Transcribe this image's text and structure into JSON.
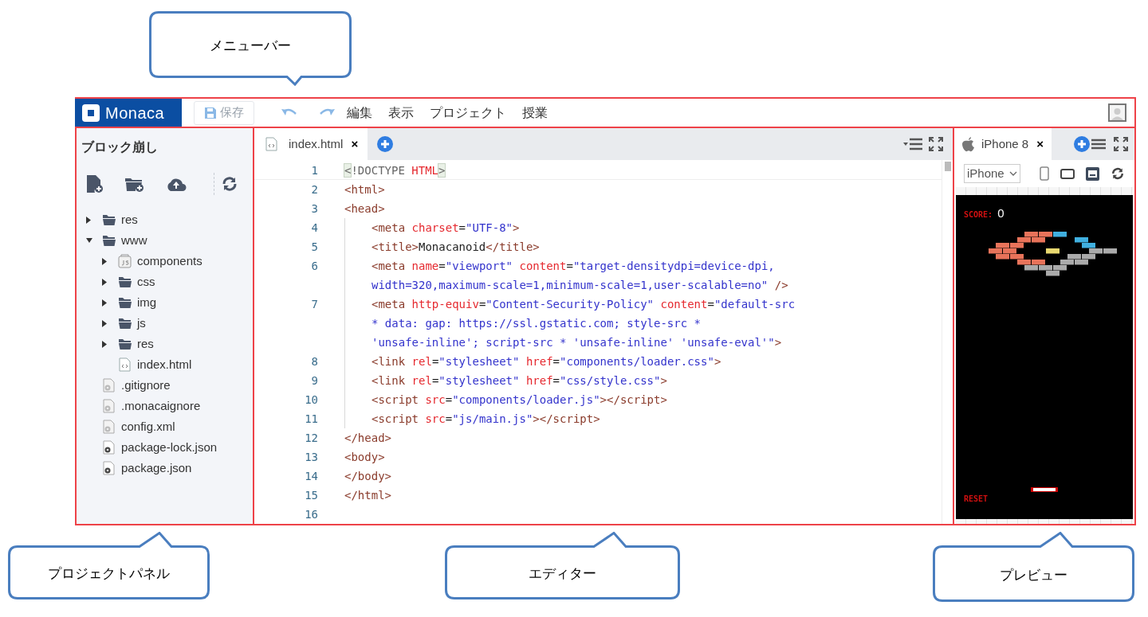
{
  "callouts": [
    {
      "label": "メニューバー",
      "kind": "down"
    },
    {
      "label": "プロジェクトパネル",
      "kind": "up"
    },
    {
      "label": "エディター",
      "kind": "up"
    },
    {
      "label": "プレビュー",
      "kind": "up"
    }
  ],
  "menubar": {
    "logo": "Monaca",
    "save": {
      "label": "保存",
      "disabled": true
    },
    "menus": [
      "編集",
      "表示",
      "プロジェクト",
      "授業"
    ]
  },
  "project_panel": {
    "title": "ブロック崩し",
    "tree": [
      {
        "label": "res",
        "kind": "folder",
        "expanded": false
      },
      {
        "label": "www",
        "kind": "folder",
        "expanded": true,
        "children": [
          {
            "label": "components",
            "kind": "js-folder",
            "expanded": false
          },
          {
            "label": "css",
            "kind": "folder",
            "expanded": false
          },
          {
            "label": "img",
            "kind": "folder",
            "expanded": false
          },
          {
            "label": "js",
            "kind": "folder",
            "expanded": false
          },
          {
            "label": "res",
            "kind": "folder",
            "expanded": false
          },
          {
            "label": "index.html",
            "kind": "html-file"
          }
        ]
      },
      {
        "label": ".gitignore",
        "kind": "config-file"
      },
      {
        "label": ".monacaignore",
        "kind": "config-file"
      },
      {
        "label": "config.xml",
        "kind": "config-file"
      },
      {
        "label": "package-lock.json",
        "kind": "json-file"
      },
      {
        "label": "package.json",
        "kind": "json-file"
      }
    ]
  },
  "editor": {
    "tab": {
      "label": "index.html",
      "close": "×",
      "selected": true
    },
    "lines": [
      {
        "number": "1",
        "indented": false,
        "tokens": [
          {
            "kind": "match",
            "text": "<"
          },
          {
            "kind": "meta",
            "text": "!DOCTYPE "
          },
          {
            "kind": "attr",
            "text": "HTML"
          },
          {
            "kind": "match",
            "text": ">"
          }
        ]
      },
      {
        "number": "2",
        "indented": false,
        "tokens": [
          {
            "kind": "tag",
            "text": "<html>"
          }
        ]
      },
      {
        "number": "3",
        "indented": false,
        "tokens": [
          {
            "kind": "tag",
            "text": "<head>"
          }
        ]
      },
      {
        "number": "4",
        "indented": true,
        "tokens": [
          {
            "kind": "tag",
            "text": "<meta "
          },
          {
            "kind": "attr",
            "text": "charset"
          },
          {
            "kind": "plain",
            "text": "="
          },
          {
            "kind": "string",
            "text": "\"UTF-8\""
          },
          {
            "kind": "tag",
            "text": ">"
          }
        ]
      },
      {
        "number": "5",
        "indented": true,
        "tokens": [
          {
            "kind": "tag",
            "text": "<title>"
          },
          {
            "kind": "plain",
            "text": "Monacanoid"
          },
          {
            "kind": "tag",
            "text": "</title>"
          }
        ]
      },
      {
        "number": "6",
        "indented": true,
        "tokens": [
          {
            "kind": "tag",
            "text": "<meta "
          },
          {
            "kind": "attr",
            "text": "name"
          },
          {
            "kind": "plain",
            "text": "="
          },
          {
            "kind": "string",
            "text": "\"viewport\" "
          },
          {
            "kind": "attr",
            "text": "content"
          },
          {
            "kind": "plain",
            "text": "="
          },
          {
            "kind": "string",
            "text": "\"target-densitydpi=device-dpi,"
          }
        ]
      },
      {
        "indented": true,
        "tokens": [
          {
            "kind": "string",
            "text": "width=320,maximum-scale=1,minimum-scale=1,user-scalable=no\""
          },
          {
            "kind": "tag",
            "text": " />"
          }
        ]
      },
      {
        "number": "7",
        "indented": true,
        "tokens": [
          {
            "kind": "tag",
            "text": "<meta "
          },
          {
            "kind": "attr",
            "text": "http-equiv"
          },
          {
            "kind": "plain",
            "text": "="
          },
          {
            "kind": "string",
            "text": "\"Content-Security-Policy\" "
          },
          {
            "kind": "attr",
            "text": "content"
          },
          {
            "kind": "plain",
            "text": "="
          },
          {
            "kind": "string",
            "text": "\"default-src"
          }
        ]
      },
      {
        "indented": true,
        "tokens": [
          {
            "kind": "string",
            "text": "* data: gap: https://ssl.gstatic.com; style-src *"
          }
        ]
      },
      {
        "indented": true,
        "tokens": [
          {
            "kind": "string",
            "text": "'unsafe-inline'; script-src * 'unsafe-inline' 'unsafe-eval'\""
          },
          {
            "kind": "tag",
            "text": ">"
          }
        ]
      },
      {
        "number": "8",
        "indented": true,
        "tokens": [
          {
            "kind": "tag",
            "text": "<link "
          },
          {
            "kind": "attr",
            "text": "rel"
          },
          {
            "kind": "plain",
            "text": "="
          },
          {
            "kind": "string",
            "text": "\"stylesheet\" "
          },
          {
            "kind": "attr",
            "text": "href"
          },
          {
            "kind": "plain",
            "text": "="
          },
          {
            "kind": "string",
            "text": "\"components/loader.css\""
          },
          {
            "kind": "tag",
            "text": ">"
          }
        ]
      },
      {
        "number": "9",
        "indented": true,
        "tokens": [
          {
            "kind": "tag",
            "text": "<link "
          },
          {
            "kind": "attr",
            "text": "rel"
          },
          {
            "kind": "plain",
            "text": "="
          },
          {
            "kind": "string",
            "text": "\"stylesheet\" "
          },
          {
            "kind": "attr",
            "text": "href"
          },
          {
            "kind": "plain",
            "text": "="
          },
          {
            "kind": "string",
            "text": "\"css/style.css\""
          },
          {
            "kind": "tag",
            "text": ">"
          }
        ]
      },
      {
        "number": "10",
        "indented": true,
        "tokens": [
          {
            "kind": "tag",
            "text": "<script "
          },
          {
            "kind": "attr",
            "text": "src"
          },
          {
            "kind": "plain",
            "text": "="
          },
          {
            "kind": "string",
            "text": "\"components/loader.js\""
          },
          {
            "kind": "tag",
            "text": "></script>"
          }
        ]
      },
      {
        "number": "11",
        "indented": true,
        "tokens": [
          {
            "kind": "tag",
            "text": "<script "
          },
          {
            "kind": "attr",
            "text": "src"
          },
          {
            "kind": "plain",
            "text": "="
          },
          {
            "kind": "string",
            "text": "\"js/main.js\""
          },
          {
            "kind": "tag",
            "text": "></script>"
          }
        ]
      },
      {
        "number": "12",
        "indented": false,
        "tokens": [
          {
            "kind": "tag",
            "text": "</head>"
          }
        ]
      },
      {
        "number": "13",
        "indented": false,
        "tokens": [
          {
            "kind": "tag",
            "text": "<body>"
          }
        ]
      },
      {
        "number": "14",
        "indented": false,
        "tokens": [
          {
            "kind": "tag",
            "text": "</body>"
          }
        ]
      },
      {
        "number": "15",
        "indented": false,
        "tokens": [
          {
            "kind": "tag",
            "text": "</html>"
          }
        ]
      },
      {
        "number": "16",
        "indented": false
      }
    ]
  },
  "preview": {
    "tab": {
      "label": "iPhone 8",
      "close": "×",
      "selected": true
    },
    "device_select": "iPhone",
    "game": {
      "score_label": "SCORE:",
      "score": "0",
      "reset": "RESET"
    }
  }
}
